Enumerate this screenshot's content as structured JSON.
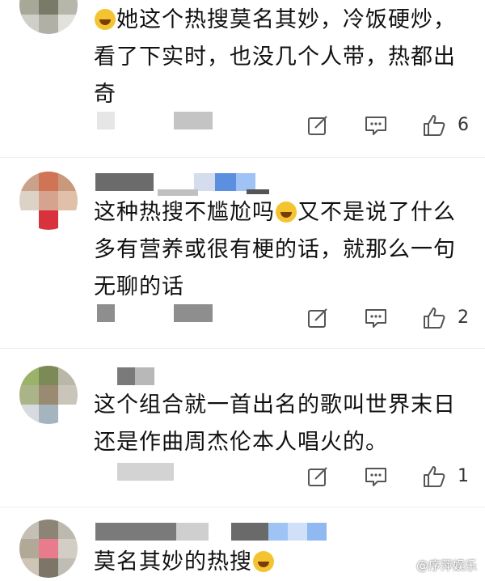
{
  "comments": [
    {
      "text_before_emoji": "",
      "emoji": "grinning-sweat-emoji",
      "text": "她这个热搜莫名其妙，冷饭硬炒，看了下实时，也没几个人带，热都出奇",
      "likes": "6"
    },
    {
      "text_before_emoji": "这种热搜不尴尬吗",
      "emoji": "sleepy-tear-emoji",
      "text": "又不是说了什么多有营养或很有梗的话，就那么一句无聊的话",
      "likes": "2"
    },
    {
      "text": "这个组合就一首出名的歌叫世界末日还是作曲周杰伦本人唱火的。",
      "likes": "1"
    },
    {
      "text_before_emoji": "莫名其妙的热搜",
      "emoji": "grinning-sweat-emoji",
      "text": ""
    }
  ],
  "watermark": "@序萍娱乐",
  "colors": {
    "icon_gray": "#555555",
    "blur_gray": "#cfcfcf",
    "blur_blue": "#8fb9f0"
  },
  "icons": [
    "edit-icon",
    "comment-icon",
    "like-icon"
  ]
}
